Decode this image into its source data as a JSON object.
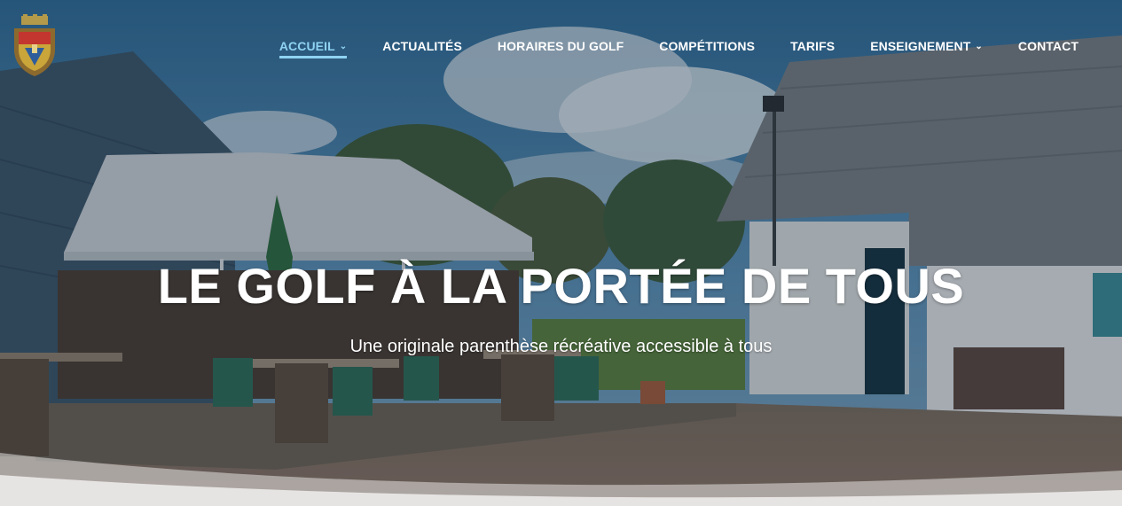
{
  "nav": {
    "items": [
      {
        "label": "ACCUEIL",
        "active": true,
        "has_dropdown": true
      },
      {
        "label": "ACTUALITÉS",
        "active": false,
        "has_dropdown": false
      },
      {
        "label": "HORAIRES DU GOLF",
        "active": false,
        "has_dropdown": false
      },
      {
        "label": "COMPÉTITIONS",
        "active": false,
        "has_dropdown": false
      },
      {
        "label": "TARIFS",
        "active": false,
        "has_dropdown": false
      },
      {
        "label": "ENSEIGNEMENT",
        "active": true,
        "has_dropdown": true
      },
      {
        "label": "CONTACT",
        "active": false,
        "has_dropdown": false
      }
    ],
    "active_color": "#8fd3f2",
    "dropdown_icon": "chevron-down-icon"
  },
  "hero": {
    "headline": "LE GOLF À LA PORTÉE DE TOUS",
    "subtitle": "Une originale parenthèse récréative accessible à tous"
  },
  "logo": {
    "icon": "coat-of-arms-logo"
  }
}
